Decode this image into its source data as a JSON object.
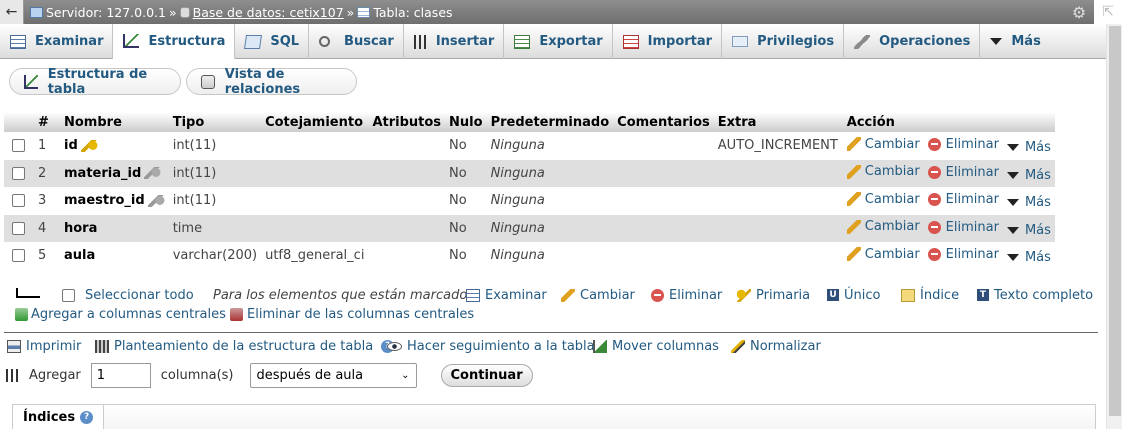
{
  "breadcrumb": {
    "server": "Servidor: 127.0.0.1",
    "database": "Base de datos: cetix107",
    "table": "Tabla: clases",
    "sep": "»"
  },
  "tabs": [
    {
      "label": "Examinar",
      "icon": "browse-icon"
    },
    {
      "label": "Estructura",
      "icon": "structure-icon"
    },
    {
      "label": "SQL",
      "icon": "sql-icon"
    },
    {
      "label": "Buscar",
      "icon": "search-icon"
    },
    {
      "label": "Insertar",
      "icon": "insert-icon"
    },
    {
      "label": "Exportar",
      "icon": "export-icon"
    },
    {
      "label": "Importar",
      "icon": "import-icon"
    },
    {
      "label": "Privilegios",
      "icon": "privileges-icon"
    },
    {
      "label": "Operaciones",
      "icon": "wrench-icon"
    },
    {
      "label": "Más",
      "icon": "chevron-down-icon"
    }
  ],
  "subtabs": {
    "structure": "Estructura de tabla",
    "relations": "Vista de relaciones"
  },
  "table": {
    "headers": [
      "#",
      "Nombre",
      "Tipo",
      "Cotejamiento",
      "Atributos",
      "Nulo",
      "Predeterminado",
      "Comentarios",
      "Extra",
      "Acción"
    ],
    "rows": [
      {
        "num": "1",
        "name": "id",
        "key": "primary",
        "type": "int(11)",
        "collation": "",
        "attributes": "",
        "null": "No",
        "default": "Ninguna",
        "comments": "",
        "extra": "AUTO_INCREMENT"
      },
      {
        "num": "2",
        "name": "materia_id",
        "key": "index",
        "type": "int(11)",
        "collation": "",
        "attributes": "",
        "null": "No",
        "default": "Ninguna",
        "comments": "",
        "extra": ""
      },
      {
        "num": "3",
        "name": "maestro_id",
        "key": "index",
        "type": "int(11)",
        "collation": "",
        "attributes": "",
        "null": "No",
        "default": "Ninguna",
        "comments": "",
        "extra": ""
      },
      {
        "num": "4",
        "name": "hora",
        "key": "",
        "type": "time",
        "collation": "",
        "attributes": "",
        "null": "No",
        "default": "Ninguna",
        "comments": "",
        "extra": ""
      },
      {
        "num": "5",
        "name": "aula",
        "key": "",
        "type": "varchar(200)",
        "collation": "utf8_general_ci",
        "attributes": "",
        "null": "No",
        "default": "Ninguna",
        "comments": "",
        "extra": ""
      }
    ],
    "actions": {
      "change": "Cambiar",
      "drop": "Eliminar",
      "more": "Más"
    }
  },
  "bulk": {
    "select_all": "Seleccionar todo",
    "with_selected": "Para los elementos que están marcados:",
    "browse": "Examinar",
    "change": "Cambiar",
    "drop": "Eliminar",
    "primary": "Primaria",
    "unique": "Único",
    "index": "Índice",
    "fulltext": "Texto completo",
    "add_central": "Agregar a columnas centrales",
    "remove_central": "Eliminar de las columnas centrales"
  },
  "tools": {
    "print": "Imprimir",
    "propose": "Planteamiento de la estructura de tabla",
    "track": "Hacer seguimiento a la tabla",
    "move": "Mover columnas",
    "normalize": "Normalizar"
  },
  "add_column": {
    "label": "Agregar",
    "count": "1",
    "unit": "columna(s)",
    "position": "después de aula",
    "button": "Continuar"
  },
  "indexes": {
    "title": "Índices"
  },
  "colors": {
    "link": "#235a81",
    "breadcrumb_bg": "#7d7d7d",
    "row_alt": "#dfdfdf",
    "delete": "#d9534f"
  }
}
